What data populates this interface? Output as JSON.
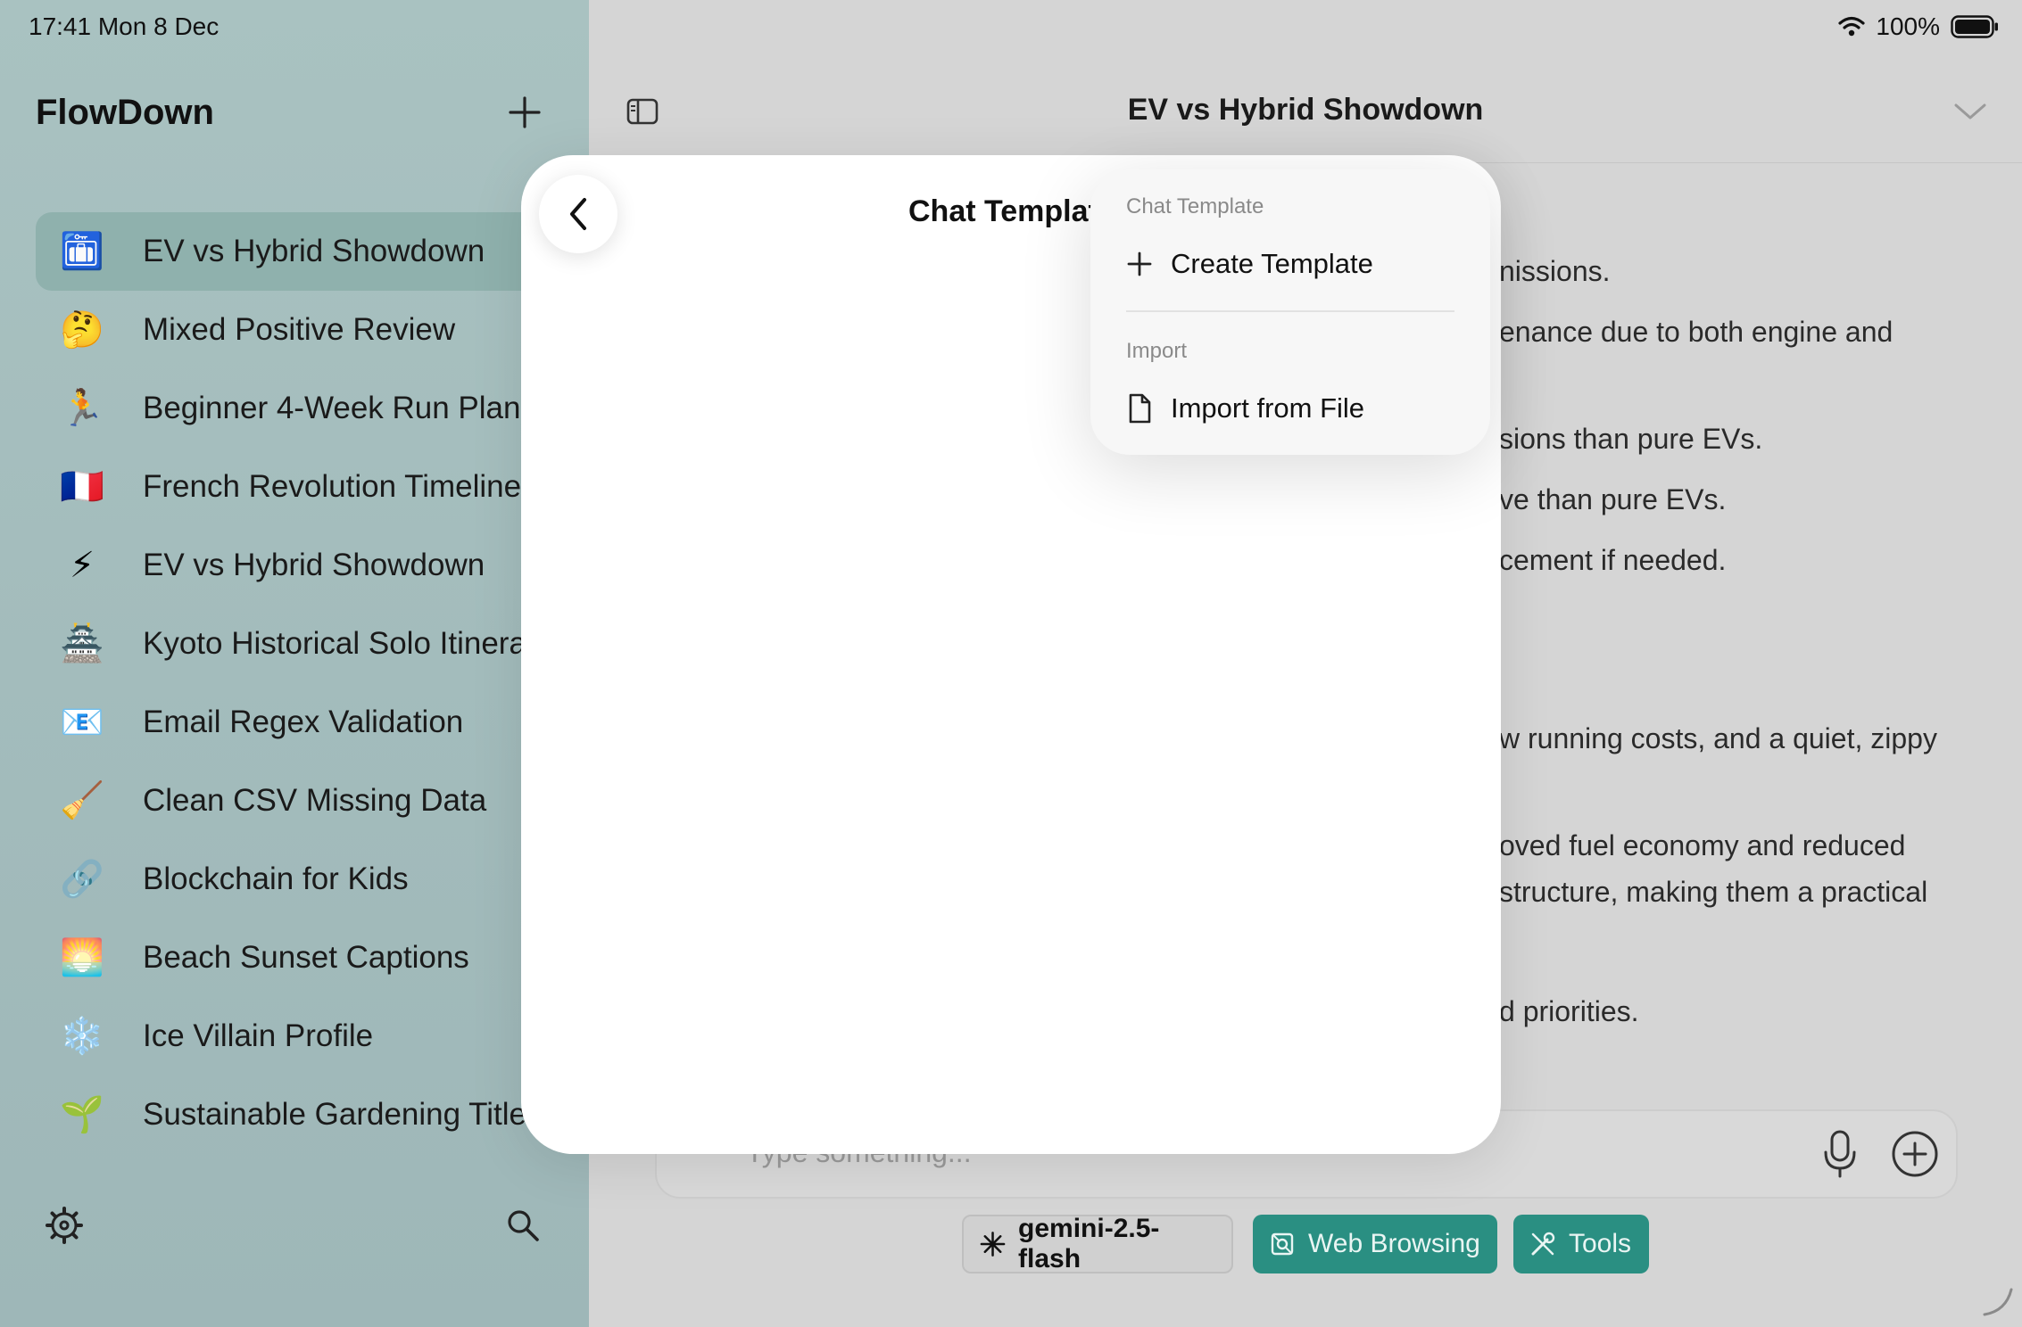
{
  "status_bar": {
    "time": "17:41  Mon 8 Dec",
    "battery": "100%"
  },
  "sidebar": {
    "app_title": "FlowDown",
    "items": [
      {
        "emoji": "🛅",
        "label": "EV vs Hybrid Showdown",
        "active": true
      },
      {
        "emoji": "🤔",
        "label": "Mixed Positive Review"
      },
      {
        "emoji": "🏃",
        "label": "Beginner 4-Week Run Plan"
      },
      {
        "emoji": "🇫🇷",
        "label": "French Revolution Timeline"
      },
      {
        "emoji": "⚡",
        "label": "EV vs Hybrid Showdown"
      },
      {
        "emoji": "🏯",
        "label": "Kyoto Historical Solo Itinerary"
      },
      {
        "emoji": "📧",
        "label": "Email Regex Validation"
      },
      {
        "emoji": "🧹",
        "label": "Clean CSV Missing Data"
      },
      {
        "emoji": "🔗",
        "label": "Blockchain for Kids"
      },
      {
        "emoji": "🌅",
        "label": "Beach Sunset Captions"
      },
      {
        "emoji": "❄️",
        "label": "Ice Villain Profile"
      },
      {
        "emoji": "🌱",
        "label": "Sustainable Gardening Titles"
      }
    ]
  },
  "main": {
    "title": "EV vs Hybrid Showdown",
    "chat_lines": [
      "nissions.",
      "enance due to both engine and",
      "sions than pure EVs.",
      "ve than pure EVs.",
      "cement if needed.",
      "w running costs, and a quiet, zippy",
      "oved fuel economy and reduced",
      "structure, making them a practical",
      "d priorities."
    ],
    "composer_placeholder": "Type something...",
    "chips": {
      "model": "gemini-2.5-flash",
      "web": "Web Browsing",
      "tools": "Tools"
    }
  },
  "modal": {
    "title": "Chat Templat"
  },
  "popup": {
    "section1": "Chat Template",
    "create": "Create Template",
    "section2": "Import",
    "import": "Import from File"
  },
  "colors": {
    "accent": "#2a8f82",
    "sidebar_bg": "#a3bcbc",
    "active_item": "#8fb1ad"
  }
}
